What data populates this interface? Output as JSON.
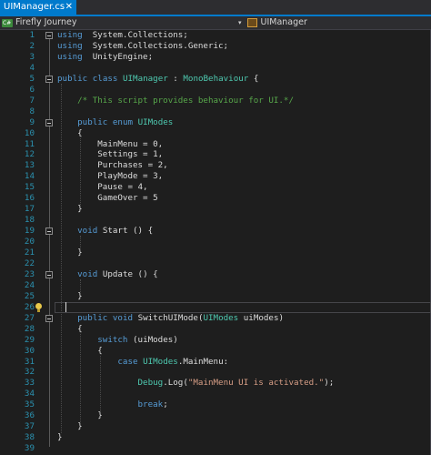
{
  "tab": {
    "title": "UIManager.cs",
    "close_glyph": "✕"
  },
  "nav": {
    "project": "Firefly Journey",
    "member": "UIManager"
  },
  "lines": [
    {
      "n": "1",
      "segs": [
        [
          "kw",
          "using"
        ],
        [
          "",
          "  System.Collections;"
        ]
      ]
    },
    {
      "n": "2",
      "segs": [
        [
          "kw",
          "using"
        ],
        [
          "",
          "  System.Collections.Generic;"
        ]
      ]
    },
    {
      "n": "3",
      "segs": [
        [
          "kw",
          "using"
        ],
        [
          "",
          "  UnityEngine;"
        ]
      ]
    },
    {
      "n": "4",
      "segs": []
    },
    {
      "n": "5",
      "segs": [
        [
          "kw",
          "public"
        ],
        [
          "",
          " "
        ],
        [
          "kw",
          "class"
        ],
        [
          "",
          " "
        ],
        [
          "ty",
          "UIManager"
        ],
        [
          "",
          " : "
        ],
        [
          "ty",
          "MonoBehaviour"
        ],
        [
          "",
          " {"
        ]
      ]
    },
    {
      "n": "6",
      "segs": []
    },
    {
      "n": "7",
      "segs": [
        [
          "",
          "    "
        ],
        [
          "cm",
          "/* This script provides behaviour for UI.*/"
        ]
      ]
    },
    {
      "n": "8",
      "segs": []
    },
    {
      "n": "9",
      "segs": [
        [
          "",
          "    "
        ],
        [
          "kw",
          "public"
        ],
        [
          "",
          " "
        ],
        [
          "kw",
          "enum"
        ],
        [
          "",
          " "
        ],
        [
          "ty",
          "UIModes"
        ]
      ]
    },
    {
      "n": "10",
      "segs": [
        [
          "",
          "    {"
        ]
      ]
    },
    {
      "n": "11",
      "segs": [
        [
          "",
          "        MainMenu = 0,"
        ]
      ]
    },
    {
      "n": "12",
      "segs": [
        [
          "",
          "        Settings = 1,"
        ]
      ]
    },
    {
      "n": "13",
      "segs": [
        [
          "",
          "        Purchases = 2,"
        ]
      ]
    },
    {
      "n": "14",
      "segs": [
        [
          "",
          "        PlayMode = 3,"
        ]
      ]
    },
    {
      "n": "15",
      "segs": [
        [
          "",
          "        Pause = 4,"
        ]
      ]
    },
    {
      "n": "16",
      "segs": [
        [
          "",
          "        GameOver = 5"
        ]
      ]
    },
    {
      "n": "17",
      "segs": [
        [
          "",
          "    }"
        ]
      ]
    },
    {
      "n": "18",
      "segs": []
    },
    {
      "n": "19",
      "segs": [
        [
          "",
          "    "
        ],
        [
          "kw",
          "void"
        ],
        [
          "",
          " Start () {"
        ]
      ]
    },
    {
      "n": "20",
      "segs": []
    },
    {
      "n": "21",
      "segs": [
        [
          "",
          "    }"
        ]
      ]
    },
    {
      "n": "22",
      "segs": []
    },
    {
      "n": "23",
      "segs": [
        [
          "",
          "    "
        ],
        [
          "kw",
          "void"
        ],
        [
          "",
          " Update () {"
        ]
      ]
    },
    {
      "n": "24",
      "segs": []
    },
    {
      "n": "25",
      "segs": [
        [
          "",
          "    }"
        ]
      ]
    },
    {
      "n": "26",
      "segs": []
    },
    {
      "n": "27",
      "segs": [
        [
          "",
          "    "
        ],
        [
          "kw",
          "public"
        ],
        [
          "",
          " "
        ],
        [
          "kw",
          "void"
        ],
        [
          "",
          " SwitchUIMode("
        ],
        [
          "ty",
          "UIModes"
        ],
        [
          "",
          " uiModes)"
        ]
      ]
    },
    {
      "n": "28",
      "segs": [
        [
          "",
          "    {"
        ]
      ]
    },
    {
      "n": "29",
      "segs": [
        [
          "",
          "        "
        ],
        [
          "kw",
          "switch"
        ],
        [
          "",
          " (uiModes)"
        ]
      ]
    },
    {
      "n": "30",
      "segs": [
        [
          "",
          "        {"
        ]
      ]
    },
    {
      "n": "31",
      "segs": [
        [
          "",
          "            "
        ],
        [
          "kw",
          "case"
        ],
        [
          "",
          " "
        ],
        [
          "ty",
          "UIModes"
        ],
        [
          "",
          ".MainMenu:"
        ]
      ]
    },
    {
      "n": "32",
      "segs": []
    },
    {
      "n": "33",
      "segs": [
        [
          "",
          "                "
        ],
        [
          "ty",
          "Debug"
        ],
        [
          "",
          ".Log("
        ],
        [
          "st",
          "\"MainMenu UI is activated.\""
        ],
        [
          "",
          ");"
        ]
      ]
    },
    {
      "n": "34",
      "segs": []
    },
    {
      "n": "35",
      "segs": [
        [
          "",
          "                "
        ],
        [
          "kw",
          "break"
        ],
        [
          "",
          ";"
        ]
      ]
    },
    {
      "n": "36",
      "segs": [
        [
          "",
          "        }"
        ]
      ]
    },
    {
      "n": "37",
      "segs": [
        [
          "",
          "    }"
        ]
      ]
    },
    {
      "n": "38",
      "segs": [
        [
          "",
          "}"
        ]
      ]
    },
    {
      "n": "39",
      "segs": []
    }
  ],
  "colors": {
    "keyword": "#569cd6",
    "type": "#4ec9b0",
    "comment": "#57a64a",
    "string": "#d69d85",
    "line_number": "#2b91af",
    "tab_accent": "#007acc"
  },
  "current_line": "26"
}
